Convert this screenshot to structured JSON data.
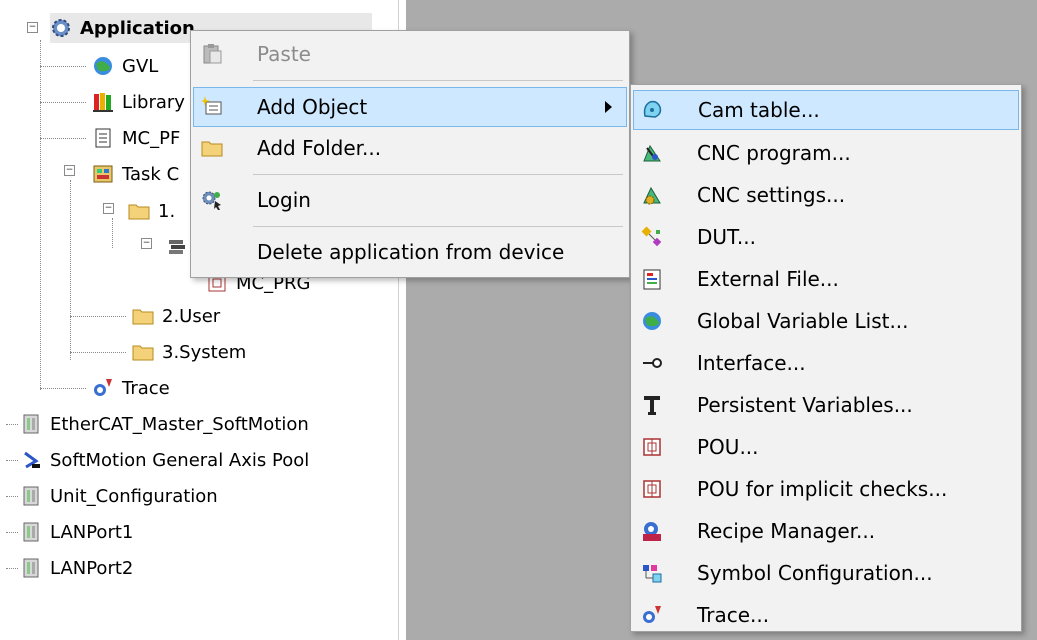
{
  "tree": {
    "application": "Application",
    "gvl": "GVL",
    "library": "Library",
    "mc_prg": "MC_PF",
    "task": "Task C",
    "task_folder": "1.",
    "mc_prg_child": "MC_PRG",
    "user": "2.User",
    "system": "3.System",
    "trace": "Trace",
    "ethercat": "EtherCAT_Master_SoftMotion",
    "softmotion_pool": "SoftMotion General Axis Pool",
    "unit_config": "Unit_Configuration",
    "lanport1": "LANPort1",
    "lanport2": "LANPort2"
  },
  "context_menu": {
    "paste": "Paste",
    "add_object": "Add Object",
    "add_folder": "Add Folder...",
    "login": "Login",
    "delete_app": "Delete application from device"
  },
  "submenu": {
    "items": [
      {
        "label": "Cam table...",
        "icon": "cam-table-icon"
      },
      {
        "label": "CNC program...",
        "icon": "cnc-program-icon"
      },
      {
        "label": "CNC settings...",
        "icon": "cnc-settings-icon"
      },
      {
        "label": "DUT...",
        "icon": "dut-icon"
      },
      {
        "label": "External File...",
        "icon": "external-file-icon"
      },
      {
        "label": "Global Variable List...",
        "icon": "globe-icon"
      },
      {
        "label": "Interface...",
        "icon": "interface-icon"
      },
      {
        "label": "Persistent Variables...",
        "icon": "persistent-vars-icon"
      },
      {
        "label": "POU...",
        "icon": "pou-icon"
      },
      {
        "label": "POU for implicit checks...",
        "icon": "pou-implicit-icon"
      },
      {
        "label": "Recipe Manager...",
        "icon": "recipe-manager-icon"
      },
      {
        "label": "Symbol Configuration...",
        "icon": "symbol-config-icon"
      },
      {
        "label": "Trace...",
        "icon": "trace-icon"
      }
    ]
  },
  "colors": {
    "highlight": "#cde8ff",
    "highlight_border": "#7ab8ec",
    "menu_bg": "#f2f2f2",
    "editor_bg": "#ababab"
  }
}
